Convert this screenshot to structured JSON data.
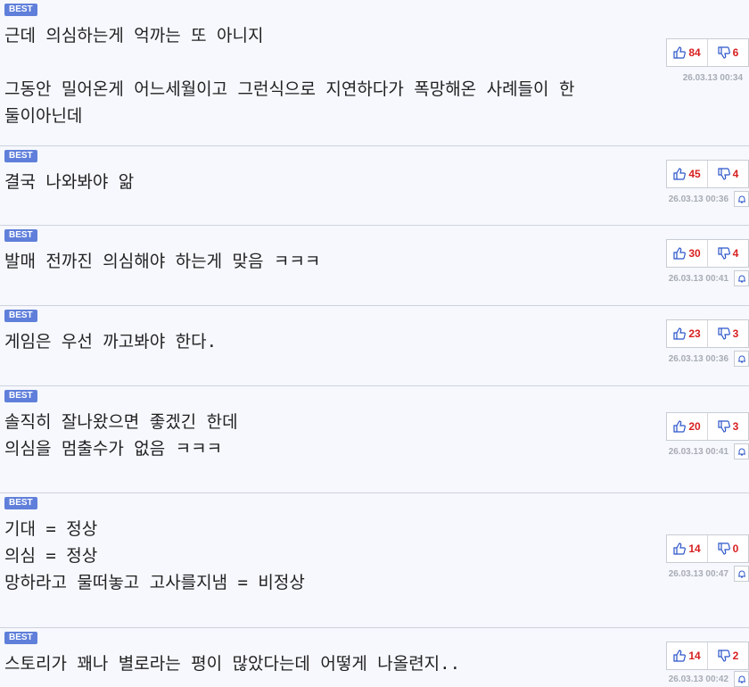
{
  "badge": "BEST",
  "comments": [
    {
      "lines": [
        "근데 의심하는게 억까는 또 아니지",
        "",
        "그동안 밀어온게 어느세월이고 그런식으로 지연하다가 폭망해온 사례들이 한",
        "둘이아닌데"
      ],
      "up": "84",
      "down": "6",
      "date": "26.03.13 00:34"
    },
    {
      "lines": [
        "결국 나와봐야 앎"
      ],
      "up": "45",
      "down": "4",
      "date": "26.03.13 00:36"
    },
    {
      "lines": [
        "발매 전까진 의심해야 하는게 맞음 ㅋㅋㅋ"
      ],
      "up": "30",
      "down": "4",
      "date": "26.03.13 00:41"
    },
    {
      "lines": [
        "게임은 우선 까고봐야 한다."
      ],
      "up": "23",
      "down": "3",
      "date": "26.03.13 00:36"
    },
    {
      "lines": [
        "솔직히 잘나왔으면 좋겠긴 한데",
        "의심을 멈출수가 없음 ㅋㅋㅋ"
      ],
      "up": "20",
      "down": "3",
      "date": "26.03.13 00:41"
    },
    {
      "lines": [
        "기대 = 정상",
        "의심 = 정상",
        "망하라고 물떠놓고 고사를지냄 = 비정상"
      ],
      "up": "14",
      "down": "0",
      "date": "26.03.13 00:47"
    },
    {
      "lines": [
        "스토리가 꽤나 별로라는 평이 많았다는데 어떻게 나올련지.."
      ],
      "up": "14",
      "down": "2",
      "date": "26.03.13 00:42"
    }
  ]
}
